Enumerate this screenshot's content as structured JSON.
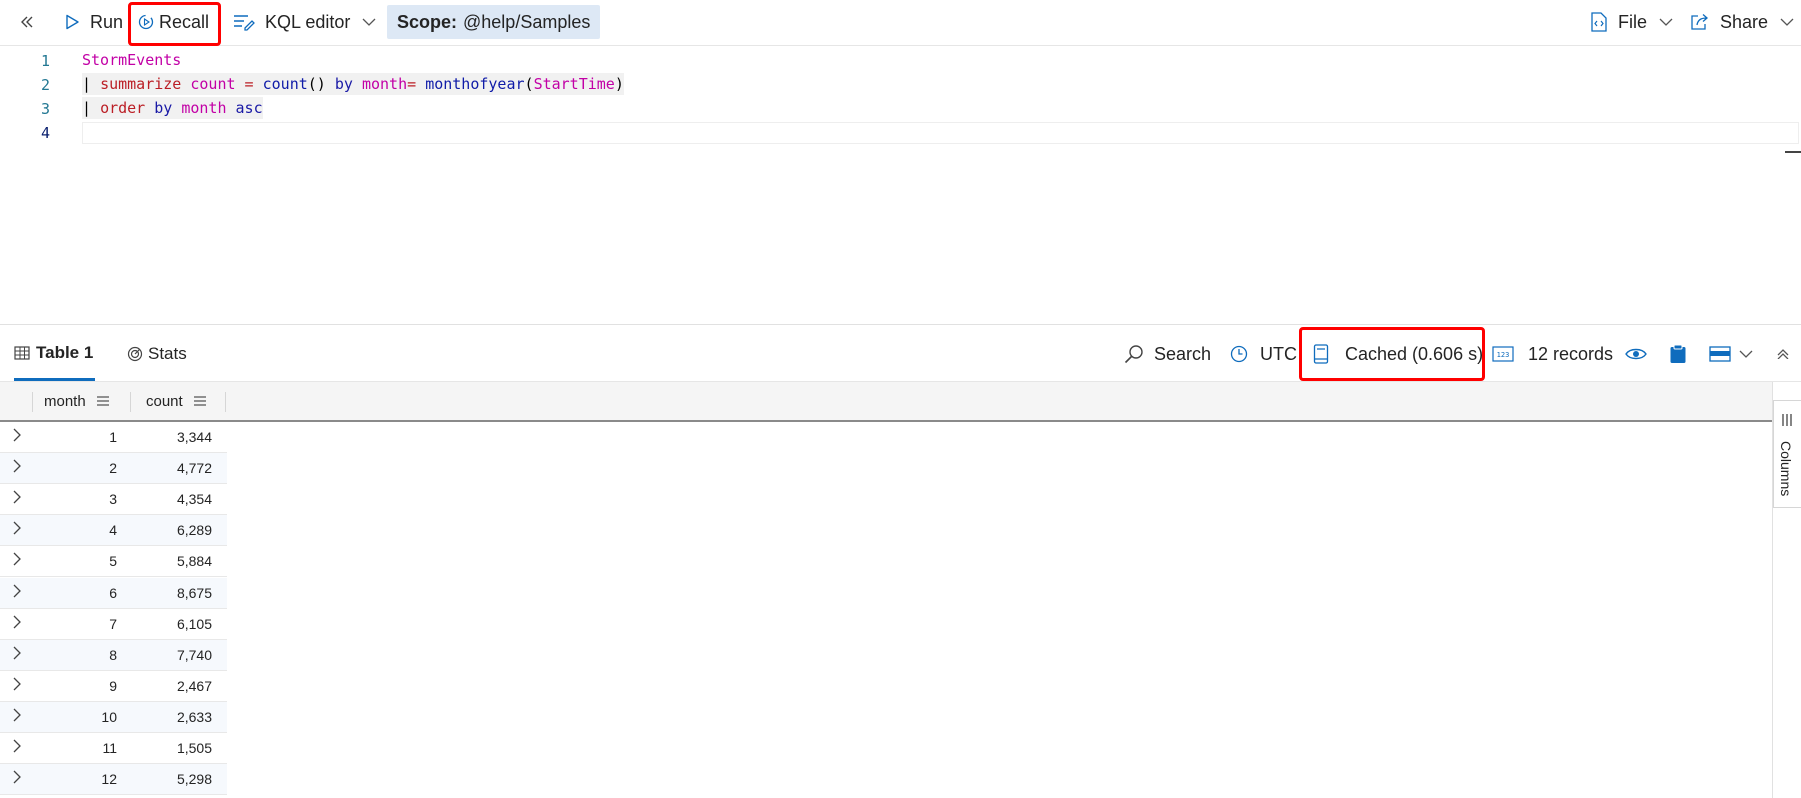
{
  "toolbar": {
    "run_label": "Run",
    "recall_label": "Recall",
    "kql_editor_label": "KQL editor",
    "scope_prefix": "Scope:",
    "scope_value": "@help/Samples",
    "file_label": "File",
    "share_label": "Share"
  },
  "editor": {
    "line_numbers": [
      "1",
      "2",
      "3",
      "4"
    ],
    "lines": [
      {
        "parts": [
          {
            "t": "StormEvents",
            "c": "kw-table"
          }
        ]
      },
      {
        "parts": [
          {
            "t": "| ",
            "c": "pipe"
          },
          {
            "t": "summarize ",
            "c": "kw-op"
          },
          {
            "t": "count",
            "c": "kw-var"
          },
          {
            "t": " = ",
            "c": "kw-op"
          },
          {
            "t": "count",
            "c": "kw-fn"
          },
          {
            "t": "() ",
            "c": "pipe"
          },
          {
            "t": "by ",
            "c": "kw-by"
          },
          {
            "t": "month",
            "c": "kw-var"
          },
          {
            "t": "= ",
            "c": "kw-op"
          },
          {
            "t": "monthofyear",
            "c": "kw-fn"
          },
          {
            "t": "(",
            "c": "pipe"
          },
          {
            "t": "StartTime",
            "c": "kw-var"
          },
          {
            "t": ")",
            "c": "pipe"
          }
        ]
      },
      {
        "parts": [
          {
            "t": "| ",
            "c": "pipe"
          },
          {
            "t": "order ",
            "c": "kw-op"
          },
          {
            "t": "by ",
            "c": "kw-by"
          },
          {
            "t": "month ",
            "c": "kw-var"
          },
          {
            "t": "asc",
            "c": "kw-by"
          }
        ]
      },
      {
        "parts": []
      }
    ]
  },
  "results": {
    "tab_table": "Table 1",
    "tab_stats": "Stats",
    "search_label": "Search",
    "utc_label": "UTC",
    "cached_label": "Cached (0.606 s)",
    "records_label": "12 records",
    "columns_label": "Columns",
    "headers": [
      "month",
      "count"
    ],
    "rows": [
      [
        "1",
        "3,344"
      ],
      [
        "2",
        "4,772"
      ],
      [
        "3",
        "4,354"
      ],
      [
        "4",
        "6,289"
      ],
      [
        "5",
        "5,884"
      ],
      [
        "6",
        "8,675"
      ],
      [
        "7",
        "6,105"
      ],
      [
        "8",
        "7,740"
      ],
      [
        "9",
        "2,467"
      ],
      [
        "10",
        "2,633"
      ],
      [
        "11",
        "1,505"
      ],
      [
        "12",
        "5,298"
      ]
    ]
  },
  "colors": {
    "accent": "#0f6cbd",
    "highlight_box": "#ff0000",
    "scope_bg": "#dde8f5"
  },
  "icons": [
    "collapse-left-icon",
    "play-icon",
    "recall-icon",
    "kql-editor-icon",
    "chevron-down-icon",
    "file-code-icon",
    "share-icon",
    "table-icon",
    "stats-icon",
    "search-icon",
    "clock-icon",
    "cache-icon",
    "records-icon",
    "eye-icon",
    "clipboard-icon",
    "layout-icon",
    "chevron-up-icon",
    "chevron-right-icon",
    "column-menu-icon",
    "columns-icon"
  ]
}
